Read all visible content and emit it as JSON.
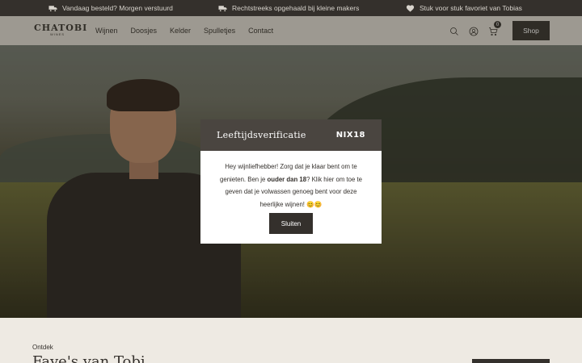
{
  "topbar": {
    "usps": [
      {
        "icon": "truck-icon",
        "text": "Vandaag besteld? Morgen verstuurd"
      },
      {
        "icon": "truck-icon",
        "text": "Rechtstreeks opgehaald bij kleine makers"
      },
      {
        "icon": "heart-icon",
        "text": "Stuk voor stuk favoriet van Tobias"
      }
    ]
  },
  "header": {
    "logo_text": "CHATOBI",
    "logo_sub": "WINES",
    "nav": [
      "Wijnen",
      "Doosjes",
      "Kelder",
      "Spulletjes",
      "Contact"
    ],
    "cart_count": "0",
    "shop_label": "Shop"
  },
  "modal": {
    "title": "Leeftijdsverificatie",
    "badge": "NIX18",
    "text_before": "Hey wijnliefhebber! Zorg dat je klaar bent om te genieten. Ben je ",
    "text_bold": "ouder dan 18",
    "text_after": "? Klik hier om toe te geven dat je volwassen genoeg bent voor deze heerlijke wijnen! 😊😊",
    "button_label": "Sluiten"
  },
  "bottom": {
    "eyebrow": "Ontdek",
    "title": "Fave's van Tobi"
  },
  "colors": {
    "dark": "#34302c",
    "header_bg": "#dcd8cf",
    "modal_head": "#4a4540"
  }
}
